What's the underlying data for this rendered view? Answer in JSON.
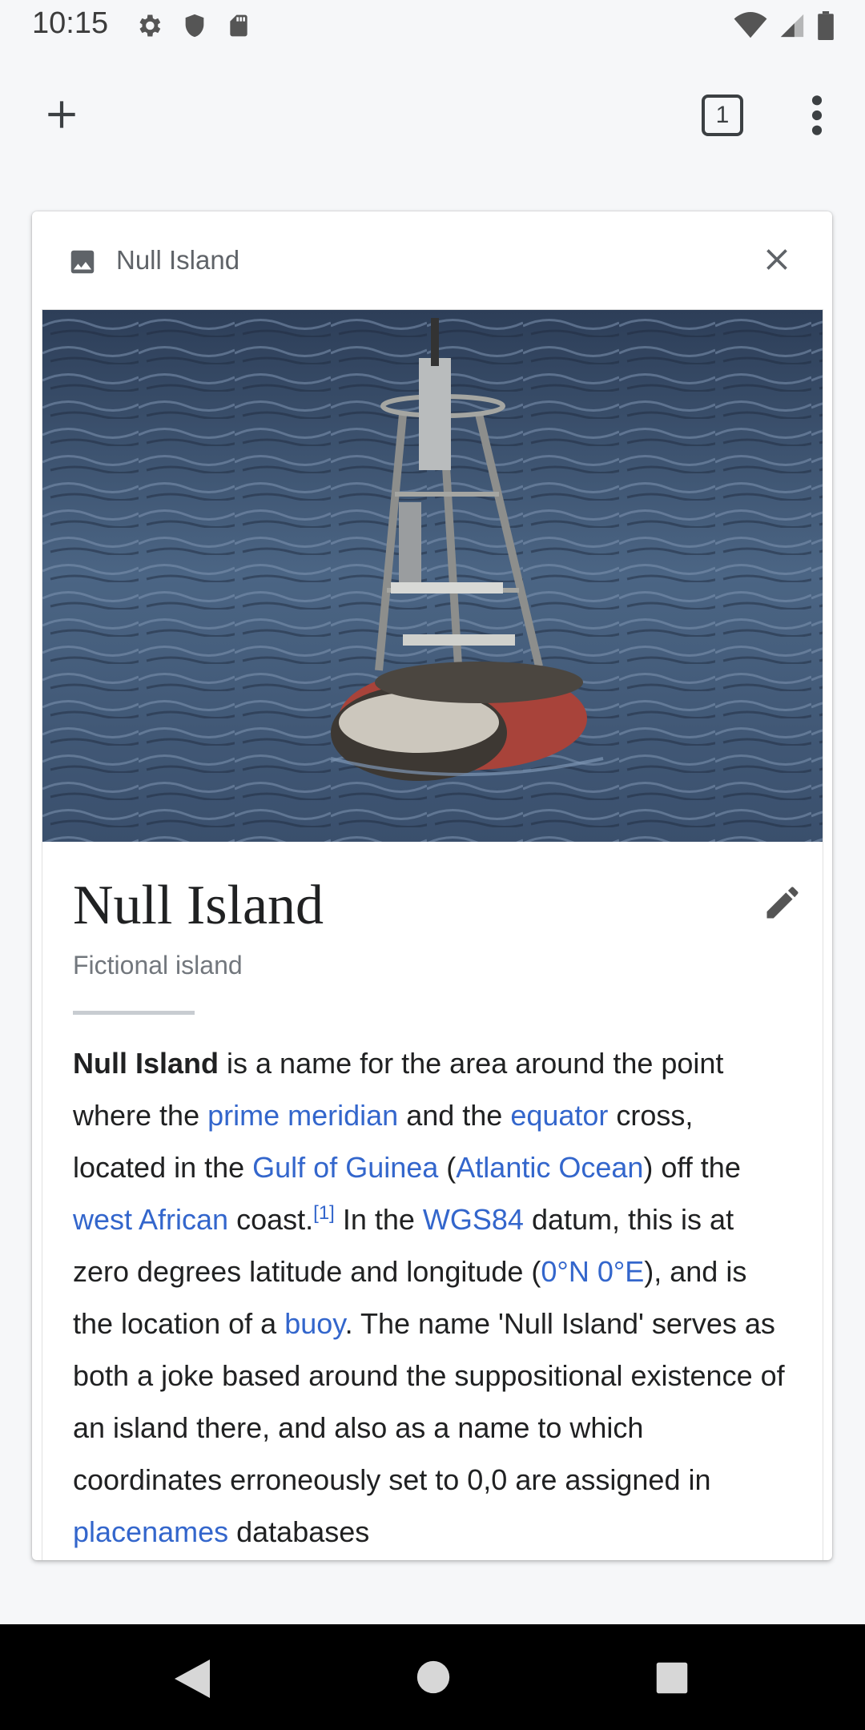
{
  "status_bar": {
    "time": "10:15",
    "left_icons": [
      "settings-icon",
      "shield-icon",
      "sd-card-icon"
    ],
    "right_icons": [
      "wifi-icon",
      "cellular-icon",
      "battery-icon"
    ]
  },
  "toolbar": {
    "new_tab_icon": "plus-icon",
    "tab_count": "1",
    "menu_icon": "more-vert-icon"
  },
  "card": {
    "title": "Null Island",
    "favicon": "image-icon",
    "close_icon": "close-icon",
    "article": {
      "title": "Null Island",
      "description": "Fictional island",
      "edit_icon": "pencil-icon",
      "body": [
        {
          "t": "Null Island",
          "b": true
        },
        {
          "t": " is a name for the area around the point where the "
        },
        {
          "t": "prime meridian",
          "l": true
        },
        {
          "t": " and the "
        },
        {
          "t": "equator",
          "l": true
        },
        {
          "t": " cross, located in the "
        },
        {
          "t": "Gulf of Guinea",
          "l": true
        },
        {
          "t": " ("
        },
        {
          "t": "Atlantic Ocean",
          "l": true
        },
        {
          "t": ") off the "
        },
        {
          "t": "west African",
          "l": true
        },
        {
          "t": " coast."
        },
        {
          "t": "[1]",
          "l": true,
          "sup": true
        },
        {
          "t": " In the "
        },
        {
          "t": "WGS84",
          "l": true
        },
        {
          "t": " datum, this is at zero degrees latitude and longitude ("
        },
        {
          "t": "0°N 0°E",
          "l": true
        },
        {
          "t": "), and is the location of a "
        },
        {
          "t": "buoy",
          "l": true
        },
        {
          "t": ". The name 'Null Island' serves as both a joke based around the suppositional existence of an island there, and also as a name to which coordinates erroneously set to 0,0 are assigned in "
        },
        {
          "t": "placenames",
          "l": true
        },
        {
          "t": " databases"
        }
      ]
    }
  },
  "colors": {
    "link": "#3366cc",
    "text": "#202122",
    "background": "#f6f7f9"
  },
  "nav_bar": {
    "icons": [
      "back-icon",
      "home-icon",
      "recents-icon"
    ]
  }
}
